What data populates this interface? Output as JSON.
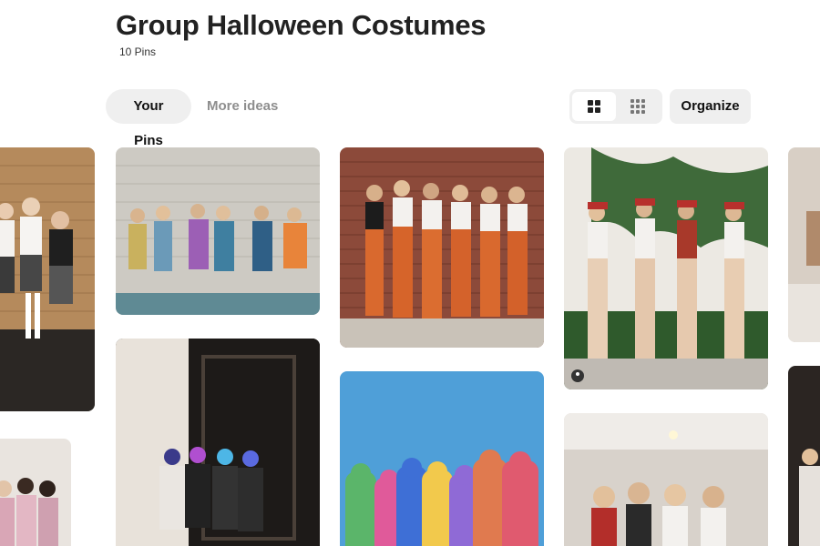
{
  "board": {
    "title": "Group Halloween Costumes",
    "pin_count": "10 Pins"
  },
  "tabs": [
    {
      "label": "Your Pins",
      "active": true
    },
    {
      "label": "More ideas",
      "active": false
    }
  ],
  "view_options": [
    {
      "icon": "grid-view-icon",
      "selected": true
    },
    {
      "icon": "compact-grid-view-icon",
      "selected": false
    }
  ],
  "organize_label": "Organize",
  "pins": [
    {
      "name": "pin-schoolgirl-costumes",
      "subject": "schoolgirl costumes by brick wall",
      "colors": [
        "#b58a5c",
        "#2a2a2a"
      ]
    },
    {
      "name": "pin-pink-costumes",
      "subject": "pink jackets group",
      "colors": [
        "#e9e4df",
        "#d9a6b6"
      ]
    },
    {
      "name": "pin-80s-costumes",
      "subject": "colorful retro group",
      "colors": [
        "#c9c6bd",
        "#6b8fb0"
      ]
    },
    {
      "name": "pin-purge-mask-costumes",
      "subject": "LED masks group",
      "colors": [
        "#1d1a18",
        "#e8e2da"
      ]
    },
    {
      "name": "pin-inmate-costumes",
      "subject": "orange jumpsuits group",
      "colors": [
        "#8c4a3a",
        "#d9692e"
      ]
    },
    {
      "name": "pin-care-bears-costumes",
      "subject": "care bears onesies",
      "colors": [
        "#4f9fd8",
        "#e05a6f"
      ]
    },
    {
      "name": "pin-pokemon-trainer-costumes",
      "subject": "red caps group with ivy",
      "colors": [
        "#ece9e3",
        "#b7302c"
      ]
    },
    {
      "name": "pin-angel-devil-costumes",
      "subject": "angel and devil group",
      "colors": [
        "#d8d2cb",
        "#6a4d3f"
      ]
    },
    {
      "name": "pin-partial-right-top",
      "subject": "partial pin",
      "colors": [
        "#d8cfc5",
        "#b08a6b"
      ]
    },
    {
      "name": "pin-partial-right-bottom",
      "subject": "partial pin",
      "colors": [
        "#2b2522",
        "#e6e1dc"
      ]
    }
  ]
}
